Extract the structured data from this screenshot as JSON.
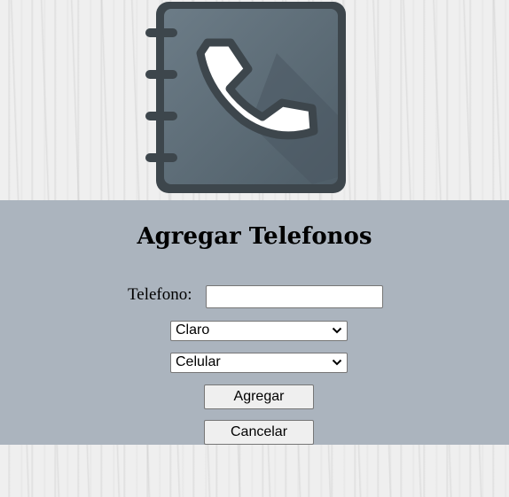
{
  "logo": {
    "icon": "phone-book-icon"
  },
  "form": {
    "title": "Agregar Telefonos",
    "phone_label": "Telefono:",
    "phone_value": "",
    "operator_select": {
      "selected": "Claro"
    },
    "type_select": {
      "selected": "Celular"
    },
    "add_button_label": "Agregar",
    "cancel_button_label": "Cancelar"
  },
  "colors": {
    "panel_background": "#abb4be",
    "book_cover": "#5b6b76",
    "book_border": "#3d464c"
  }
}
